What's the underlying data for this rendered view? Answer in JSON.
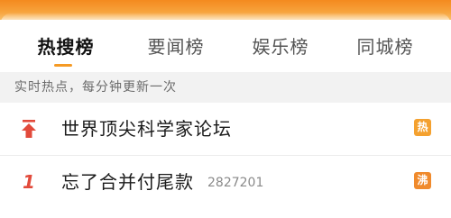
{
  "tabs": [
    {
      "label": "热搜榜",
      "active": true
    },
    {
      "label": "要闻榜",
      "active": false
    },
    {
      "label": "娱乐榜",
      "active": false
    },
    {
      "label": "同城榜",
      "active": false
    }
  ],
  "subheader": "实时热点，每分钟更新一次",
  "rows": [
    {
      "rank_icon": "pin-top-icon",
      "title": "世界顶尖科学家论坛",
      "count": "",
      "badge": "热",
      "badge_color": "#f4a12f"
    },
    {
      "rank": "1",
      "title": "忘了合并付尾款",
      "count": "2827201",
      "badge": "沸",
      "badge_color": "#f08a2c"
    }
  ],
  "colors": {
    "accent": "#f59a24",
    "rank_red": "#e24a3b",
    "header_orange": "#f48a1f"
  }
}
